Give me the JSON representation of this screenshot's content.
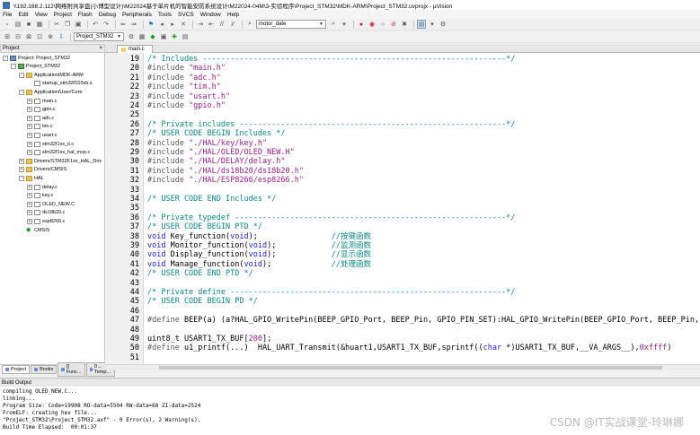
{
  "window": {
    "title": "\\\\192.168.2.112\\网络附共享盘(小博型设计)\\M22024基于单片机的智能安防系统设计\\M22024-04M\\3-实验程序\\Project_STM32\\MDK-ARM\\Project_STM32.uvprojx - µVision"
  },
  "menu": [
    "File",
    "Edit",
    "View",
    "Project",
    "Flash",
    "Debug",
    "Peripherals",
    "Tools",
    "SVCS",
    "Window",
    "Help"
  ],
  "toolbar": {
    "find_combo_value": "motor_date",
    "target_combo_value": "Project_STM32"
  },
  "project_panel": {
    "header": "Project",
    "close": "×",
    "tabs": [
      "Project",
      "Books",
      "{} Func...",
      "0→ Temp..."
    ]
  },
  "tree": [
    {
      "label": "Project: Project_STM32",
      "indent": 0,
      "icon": "proj",
      "toggle": "-"
    },
    {
      "label": "Project_STM32",
      "indent": 1,
      "icon": "target",
      "toggle": "-"
    },
    {
      "label": "Application/MDK-ARM",
      "indent": 2,
      "icon": "folder",
      "toggle": "-"
    },
    {
      "label": "startup_stm32f103xb.s",
      "indent": 3,
      "icon": "file",
      "toggle": ""
    },
    {
      "label": "Application/User/Core",
      "indent": 2,
      "icon": "folder",
      "toggle": "-"
    },
    {
      "label": "main.c",
      "indent": 3,
      "icon": "file",
      "toggle": "+"
    },
    {
      "label": "gpio.c",
      "indent": 3,
      "icon": "file",
      "toggle": "+"
    },
    {
      "label": "adc.c",
      "indent": 3,
      "icon": "file",
      "toggle": "+"
    },
    {
      "label": "tim.c",
      "indent": 3,
      "icon": "file",
      "toggle": "+"
    },
    {
      "label": "usart.c",
      "indent": 3,
      "icon": "file",
      "toggle": "+"
    },
    {
      "label": "stm32f1xx_it.c",
      "indent": 3,
      "icon": "file",
      "toggle": "+"
    },
    {
      "label": "stm32f1xx_hal_msp.c",
      "indent": 3,
      "icon": "file",
      "toggle": "+"
    },
    {
      "label": "Drivers/STM32F1xx_HAL_Driv",
      "indent": 2,
      "icon": "folder",
      "toggle": "+"
    },
    {
      "label": "Drivers/CMSIS",
      "indent": 2,
      "icon": "folder",
      "toggle": "+"
    },
    {
      "label": "HAL",
      "indent": 2,
      "icon": "folder",
      "toggle": "-"
    },
    {
      "label": "delay.c",
      "indent": 3,
      "icon": "file",
      "toggle": "+"
    },
    {
      "label": "key.c",
      "indent": 3,
      "icon": "file",
      "toggle": "+"
    },
    {
      "label": "OLED_NEW.C",
      "indent": 3,
      "icon": "file",
      "toggle": "+"
    },
    {
      "label": "ds18b20.c",
      "indent": 3,
      "icon": "file",
      "toggle": "+"
    },
    {
      "label": "esp8266.c",
      "indent": 3,
      "icon": "file",
      "toggle": "+"
    },
    {
      "label": "CMSIS",
      "indent": 2,
      "icon": "gem",
      "toggle": ""
    }
  ],
  "editor": {
    "active_tab": "main.c",
    "lines": [
      {
        "n": "19",
        "parts": [
          [
            "c-com",
            "/* Includes ------------------------------------------------------------------*/"
          ]
        ]
      },
      {
        "n": "20",
        "parts": [
          [
            "c-pp",
            "#include "
          ],
          [
            "c-str",
            "\"main.h\""
          ]
        ]
      },
      {
        "n": "21",
        "parts": [
          [
            "c-pp",
            "#include "
          ],
          [
            "c-str",
            "\"adc.h\""
          ]
        ]
      },
      {
        "n": "22",
        "parts": [
          [
            "c-pp",
            "#include "
          ],
          [
            "c-str",
            "\"tim.h\""
          ]
        ]
      },
      {
        "n": "23",
        "parts": [
          [
            "c-pp",
            "#include "
          ],
          [
            "c-str",
            "\"usart.h\""
          ]
        ]
      },
      {
        "n": "24",
        "parts": [
          [
            "c-pp",
            "#include "
          ],
          [
            "c-str",
            "\"gpio.h\""
          ]
        ]
      },
      {
        "n": "25",
        "parts": []
      },
      {
        "n": "26",
        "parts": [
          [
            "c-com",
            "/* Private includes ----------------------------------------------------------*/"
          ]
        ]
      },
      {
        "n": "27",
        "parts": [
          [
            "c-com",
            "/* USER CODE BEGIN Includes */"
          ]
        ]
      },
      {
        "n": "28",
        "parts": [
          [
            "c-pp",
            "#include "
          ],
          [
            "c-str",
            "\"./HAL/key/key.h\""
          ]
        ]
      },
      {
        "n": "29",
        "parts": [
          [
            "c-pp",
            "#include "
          ],
          [
            "c-str",
            "\"./HAL/OLED/OLED_NEW.H\""
          ]
        ]
      },
      {
        "n": "30",
        "parts": [
          [
            "c-pp",
            "#include "
          ],
          [
            "c-str",
            "\"./HAL/DELAY/delay.h\""
          ]
        ]
      },
      {
        "n": "31",
        "parts": [
          [
            "c-pp",
            "#include "
          ],
          [
            "c-str",
            "\"./HAL/ds18b20/ds18b20.h\""
          ]
        ]
      },
      {
        "n": "32",
        "parts": [
          [
            "c-pp",
            "#include "
          ],
          [
            "c-str",
            "\"./HAL/ESP8266/esp8266.h\""
          ]
        ]
      },
      {
        "n": "33",
        "parts": []
      },
      {
        "n": "34",
        "parts": [
          [
            "c-com",
            "/* USER CODE END Includes */"
          ]
        ]
      },
      {
        "n": "35",
        "parts": []
      },
      {
        "n": "36",
        "parts": [
          [
            "c-com",
            "/* Private typedef -----------------------------------------------------------*/"
          ]
        ]
      },
      {
        "n": "37",
        "parts": [
          [
            "c-com",
            "/* USER CODE BEGIN PTD */"
          ]
        ]
      },
      {
        "n": "38",
        "parts": [
          [
            "c-kw",
            "void"
          ],
          [
            "c-plain",
            " Key_function("
          ],
          [
            "c-kw",
            "void"
          ],
          [
            "c-plain",
            ");                "
          ],
          [
            "c-com",
            "//按键函数"
          ]
        ]
      },
      {
        "n": "39",
        "parts": [
          [
            "c-kw",
            "void"
          ],
          [
            "c-plain",
            " Monitor_function("
          ],
          [
            "c-kw",
            "void"
          ],
          [
            "c-plain",
            ");            "
          ],
          [
            "c-com",
            "//监测函数"
          ]
        ]
      },
      {
        "n": "40",
        "parts": [
          [
            "c-kw",
            "void"
          ],
          [
            "c-plain",
            " Display_function("
          ],
          [
            "c-kw",
            "void"
          ],
          [
            "c-plain",
            ");            "
          ],
          [
            "c-com",
            "//显示函数"
          ]
        ]
      },
      {
        "n": "41",
        "parts": [
          [
            "c-kw",
            "void"
          ],
          [
            "c-plain",
            " Manage_function("
          ],
          [
            "c-kw",
            "void"
          ],
          [
            "c-plain",
            ");             "
          ],
          [
            "c-com",
            "//处理函数"
          ]
        ]
      },
      {
        "n": "42",
        "parts": [
          [
            "c-com",
            "/* USER CODE END PTD */"
          ]
        ]
      },
      {
        "n": "43",
        "parts": []
      },
      {
        "n": "44",
        "parts": [
          [
            "c-com",
            "/* Private define ------------------------------------------------------------*/"
          ]
        ]
      },
      {
        "n": "45",
        "parts": [
          [
            "c-com",
            "/* USER CODE BEGIN PD */"
          ]
        ]
      },
      {
        "n": "46",
        "parts": []
      },
      {
        "n": "47",
        "parts": [
          [
            "c-pp",
            "#define"
          ],
          [
            "c-plain",
            " BEEP(a) (a?HAL_GPIO_WritePin(BEEP_GPIO_Port, BEEP_Pin, GPIO_PIN_SET):HAL_GPIO_WritePin(BEEP_GPIO_Port, BEEP_Pin, GPIO_PIN_RESET))"
          ]
        ]
      },
      {
        "n": "48",
        "parts": []
      },
      {
        "n": "49",
        "parts": [
          [
            "c-plain",
            "uint8_t USART1_TX_BUF["
          ],
          [
            "c-num",
            "200"
          ],
          [
            "c-plain",
            "];"
          ]
        ]
      },
      {
        "n": "50",
        "parts": [
          [
            "c-pp",
            "#define"
          ],
          [
            "c-plain",
            " u1_printf(...)  HAL_UART_Transmit(&huart1,USART1_TX_BUF,sprintf(("
          ],
          [
            "c-kw",
            "char"
          ],
          [
            "c-plain",
            " *)USART1_TX_BUF,__VA_ARGS__),"
          ],
          [
            "c-num",
            "0xffff"
          ],
          [
            "c-plain",
            ")"
          ]
        ]
      },
      {
        "n": "51",
        "parts": []
      }
    ]
  },
  "build": {
    "header": "Build Output",
    "lines": [
      "compiling OLED_NEW.C...",
      "linking...",
      "Program Size: Code=19908 RO-data=5504 RW-data=68 ZI-data=2524",
      "FromELF: creating hex file...",
      "\"Project_STM32\\Project_STM32.axf\" - 0 Error(s), 2 Warning(s).",
      "Build Time Elapsed:  00:01:37"
    ]
  },
  "watermark": "CSDN @IT实战课堂-玲琳娜"
}
